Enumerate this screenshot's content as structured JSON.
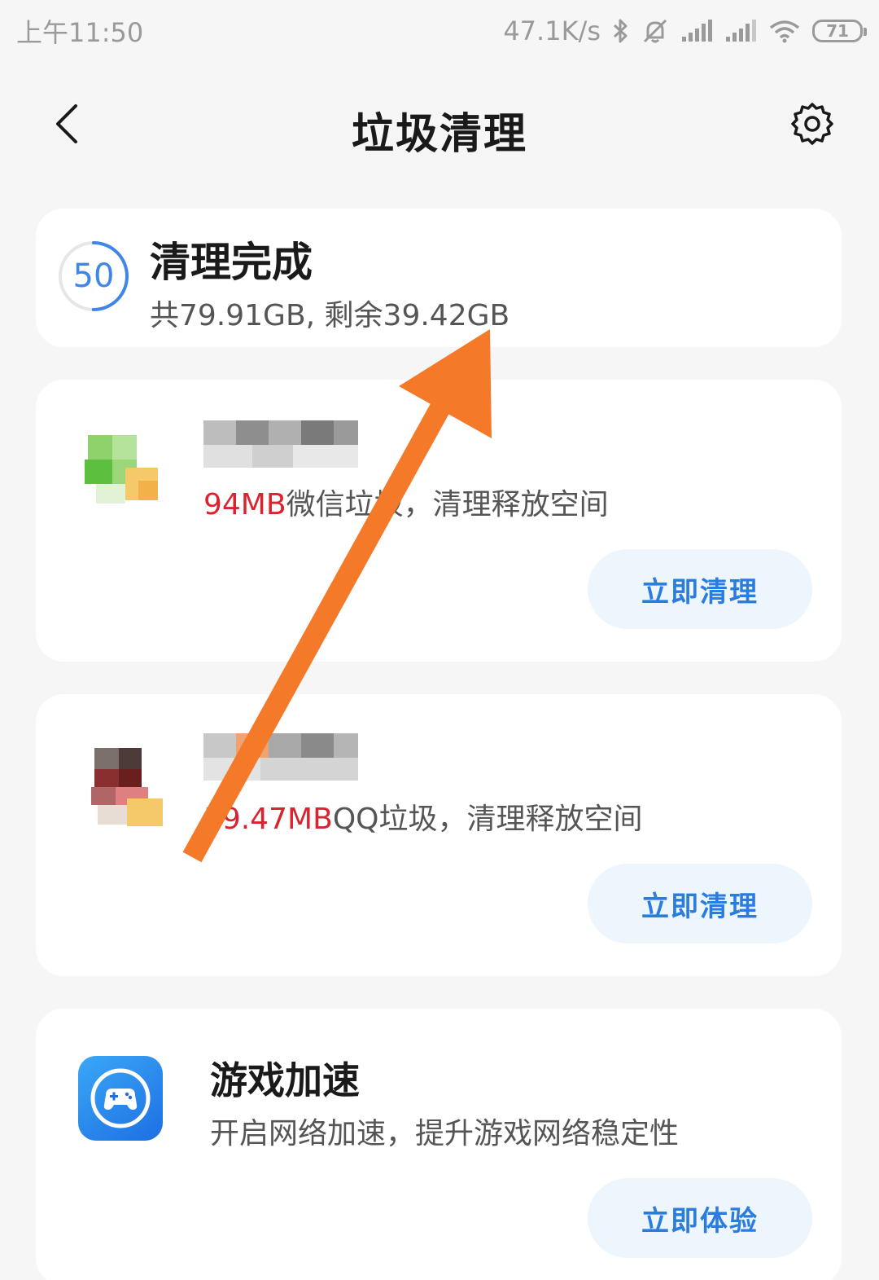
{
  "status_bar": {
    "time": "上午11:50",
    "network_speed": "47.1K/s",
    "battery": "71"
  },
  "header": {
    "title": "垃圾清理",
    "back_icon": "chevron-left-icon",
    "settings_icon": "gear-icon"
  },
  "summary": {
    "score": "50",
    "score_progress": 0.5,
    "title": "清理完成",
    "storage_text": "共79.91GB, 剩余39.42GB",
    "ring_color": "#3f86e8"
  },
  "wechat_card": {
    "amount": "94MB",
    "desc_suffix": "微信垃圾，清理释放空间",
    "button": "立即清理"
  },
  "qq_card": {
    "amount": "59.47MB",
    "desc_suffix": "QQ垃圾，清理释放空间",
    "button": "立即清理"
  },
  "game_card": {
    "title": "游戏加速",
    "desc": "开启网络加速，提升游戏网络稳定性",
    "button": "立即体验",
    "icon": "gamepad-icon"
  },
  "colors": {
    "accent": "#2a7ce0",
    "button_bg": "#edf5fd",
    "amount_red": "#d9232e",
    "arrow": "#f47a2a"
  }
}
